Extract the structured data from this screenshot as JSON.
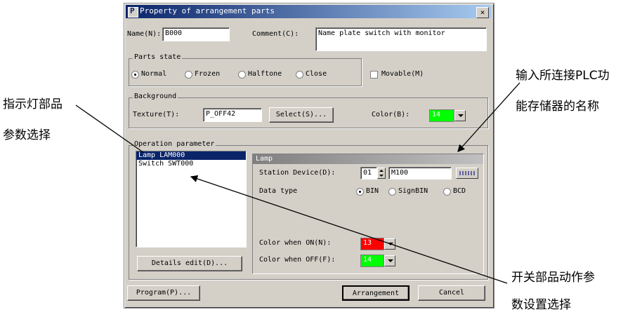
{
  "dialog": {
    "title": "Property of arrangement parts",
    "close_label": "×",
    "name_label": "Name(N):",
    "name_value": "B000",
    "comment_label": "Comment(C):",
    "comment_value": "Name plate switch with monitor",
    "parts_state": {
      "title": "Parts state",
      "options": [
        "Normal",
        "Frozen",
        "Halftone",
        "Close"
      ],
      "selected": "Normal",
      "movable_label": "Movable(M)",
      "movable_checked": false
    },
    "background": {
      "title": "Background",
      "texture_label": "Texture(T):",
      "texture_value": "P_OFF42",
      "select_button": "Select(S)...",
      "color_label": "Color(B):",
      "color_value": "14",
      "color_hex": "#00ff00"
    },
    "operation": {
      "title": "Operation parameter",
      "items": [
        "Lamp LAM000",
        "Switch SWT000"
      ],
      "selected_index": 0,
      "details_button": "Details edit(D)...",
      "lamp": {
        "title": "Lamp",
        "station_label": "Station Device(D):",
        "station_value": "01",
        "device_value": "M100",
        "data_type_label": "Data type",
        "data_types": [
          "BIN",
          "SignBIN",
          "BCD"
        ],
        "data_type_selected": "BIN",
        "color_on_label": "Color when ON(N):",
        "color_on_value": "13",
        "color_on_hex": "#ff0000",
        "color_off_label": "Color when OFF(F):",
        "color_off_value": "14",
        "color_off_hex": "#00ff00"
      }
    },
    "program_button": "Program(P)...",
    "arrangement_button": "Arrangement",
    "cancel_button": "Cancel"
  },
  "annotations": {
    "left_line1": "指示灯部品",
    "left_line2": "参数选择",
    "right_top_line1": "输入所连接PLC功",
    "right_top_line2": "能存储器的名称",
    "right_bottom_line1": "开关部品动作参",
    "right_bottom_line2": "数设置选择"
  }
}
